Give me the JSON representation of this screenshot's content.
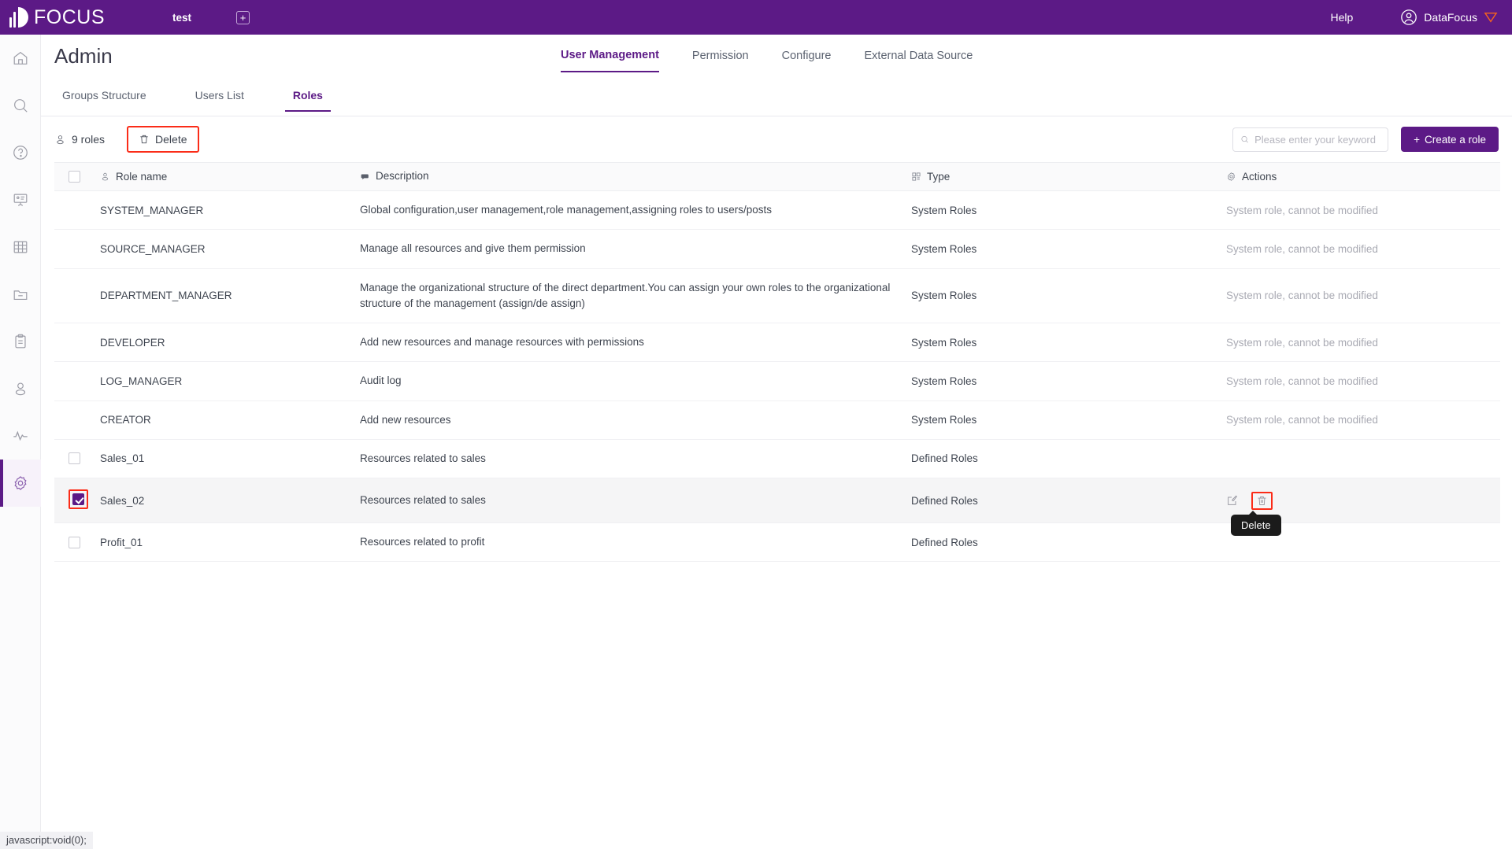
{
  "topbar": {
    "brand": "FOCUS",
    "brand_icon": "focus-logo-icon",
    "tab_name": "test",
    "add_tab_icon": "plus-square-icon",
    "help": "Help",
    "user_name": "DataFocus",
    "avatar_icon": "user-circle-icon",
    "badge_icon": "shield-badge-icon",
    "bar_color": "#5c1a86"
  },
  "rail": {
    "items": [
      {
        "icon": "home-icon",
        "active": false
      },
      {
        "icon": "search-icon",
        "active": false
      },
      {
        "icon": "question-circle-icon",
        "active": false
      },
      {
        "icon": "presentation-icon",
        "active": false
      },
      {
        "icon": "table-grid-icon",
        "active": false
      },
      {
        "icon": "folder-minus-icon",
        "active": false
      },
      {
        "icon": "clipboard-icon",
        "active": false
      },
      {
        "icon": "user-icon",
        "active": false
      },
      {
        "icon": "activity-pulse-icon",
        "active": false
      },
      {
        "icon": "gear-icon",
        "active": true
      }
    ]
  },
  "page": {
    "title": "Admin",
    "main_tabs": [
      {
        "label": "User Management",
        "active": true
      },
      {
        "label": "Permission",
        "active": false
      },
      {
        "label": "Configure",
        "active": false
      },
      {
        "label": "External Data Source",
        "active": false
      }
    ],
    "sub_tabs": [
      {
        "label": "Groups Structure",
        "active": false
      },
      {
        "label": "Users List",
        "active": false
      },
      {
        "label": "Roles",
        "active": true
      }
    ]
  },
  "toolbar": {
    "count_icon": "user-icon",
    "count_label": "9 roles",
    "delete_icon": "trash-icon",
    "delete_label": "Delete",
    "delete_highlight_color": "#fb2c18",
    "search_icon": "search-icon",
    "search_placeholder": "Please enter your keyword",
    "search_value": "",
    "create_label": "Create a role",
    "create_icon": "plus-icon",
    "create_color": "#5c1a86"
  },
  "table": {
    "headers": {
      "checkbox": "select-all",
      "name": {
        "label": "Role name",
        "icon": "user-icon"
      },
      "description": {
        "label": "Description",
        "icon": "comment-icon"
      },
      "type": {
        "label": "Type",
        "icon": "blocks-icon"
      },
      "actions": {
        "label": "Actions",
        "icon": "gear-icon"
      }
    },
    "system_note": "System role, cannot be modified",
    "rows": [
      {
        "name": "SYSTEM_MANAGER",
        "description": "Global configuration,user management,role management,assigning roles to users/posts",
        "type": "System Roles",
        "system": true,
        "checked": false,
        "selected": false
      },
      {
        "name": "SOURCE_MANAGER",
        "description": "Manage all resources and give them permission",
        "type": "System Roles",
        "system": true,
        "checked": false,
        "selected": false
      },
      {
        "name": "DEPARTMENT_MANAGER",
        "description": "Manage the organizational structure of the direct department.You can assign your own roles to the organizational structure of the management (assign/de assign)",
        "type": "System Roles",
        "system": true,
        "checked": false,
        "selected": false
      },
      {
        "name": "DEVELOPER",
        "description": "Add new resources and manage resources with permissions",
        "type": "System Roles",
        "system": true,
        "checked": false,
        "selected": false
      },
      {
        "name": "LOG_MANAGER",
        "description": "Audit log",
        "type": "System Roles",
        "system": true,
        "checked": false,
        "selected": false
      },
      {
        "name": "CREATOR",
        "description": "Add new resources",
        "type": "System Roles",
        "system": true,
        "checked": false,
        "selected": false
      },
      {
        "name": "Sales_01",
        "description": "Resources related to sales",
        "type": "Defined Roles",
        "system": false,
        "checked": false,
        "selected": false
      },
      {
        "name": "Sales_02",
        "description": "Resources related to sales",
        "type": "Defined Roles",
        "system": false,
        "checked": true,
        "selected": true
      },
      {
        "name": "Profit_01",
        "description": "Resources related to profit",
        "type": "Defined Roles",
        "system": false,
        "checked": false,
        "selected": false
      }
    ],
    "row_actions": {
      "edit_icon": "edit-icon",
      "delete_icon": "trash-icon"
    },
    "tooltip": "Delete"
  },
  "statusbar": {
    "text": "javascript:void(0);"
  }
}
